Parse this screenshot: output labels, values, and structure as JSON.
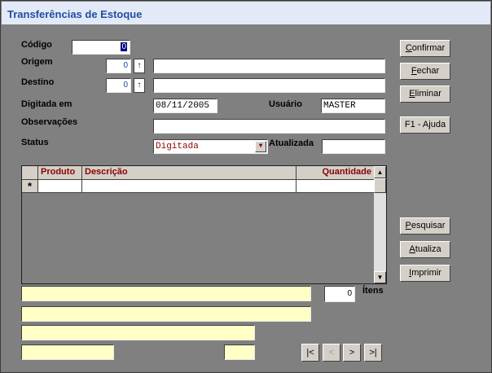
{
  "window": {
    "title": "Transferências de Estoque"
  },
  "form": {
    "codigo_label": "Código",
    "codigo_value": "0",
    "origem_label": "Origem",
    "origem_value": "0",
    "origem_desc": "",
    "destino_label": "Destino",
    "destino_value": "0",
    "destino_desc": "",
    "digitada_label": "Digitada em",
    "digitada_value": "08/11/2005",
    "usuario_label": "Usuário",
    "usuario_value": "MASTER",
    "observacoes_label": "Observações",
    "observacoes_value": "",
    "status_label": "Status",
    "status_value": "Digitada",
    "atualizada_label": "Atualizada",
    "atualizada_value": ""
  },
  "buttons": {
    "confirmar_first": "C",
    "confirmar_rest": "onfirmar",
    "fechar_first": "F",
    "fechar_rest": "echar",
    "eliminar_first": "E",
    "eliminar_rest": "liminar",
    "ajuda": "F1 - Ajuda",
    "pesquisar_first": "P",
    "pesquisar_rest": "esquisar",
    "atualiza_first": "A",
    "atualiza_rest": "tualiza",
    "imprimir_first": "I",
    "imprimir_rest": "mprimir"
  },
  "grid": {
    "columns": [
      "Produto",
      "Descrição",
      "Quantidade"
    ],
    "new_row_marker": "*"
  },
  "footer": {
    "itens_count": "0",
    "itens_label": "Ítens"
  },
  "nav": {
    "first": "|<",
    "prev": "<",
    "next": ">",
    "last": ">|"
  },
  "icons": [
    "up-arrow-icon",
    "dropdown-icon",
    "scroll-up-icon",
    "scroll-down-icon"
  ]
}
